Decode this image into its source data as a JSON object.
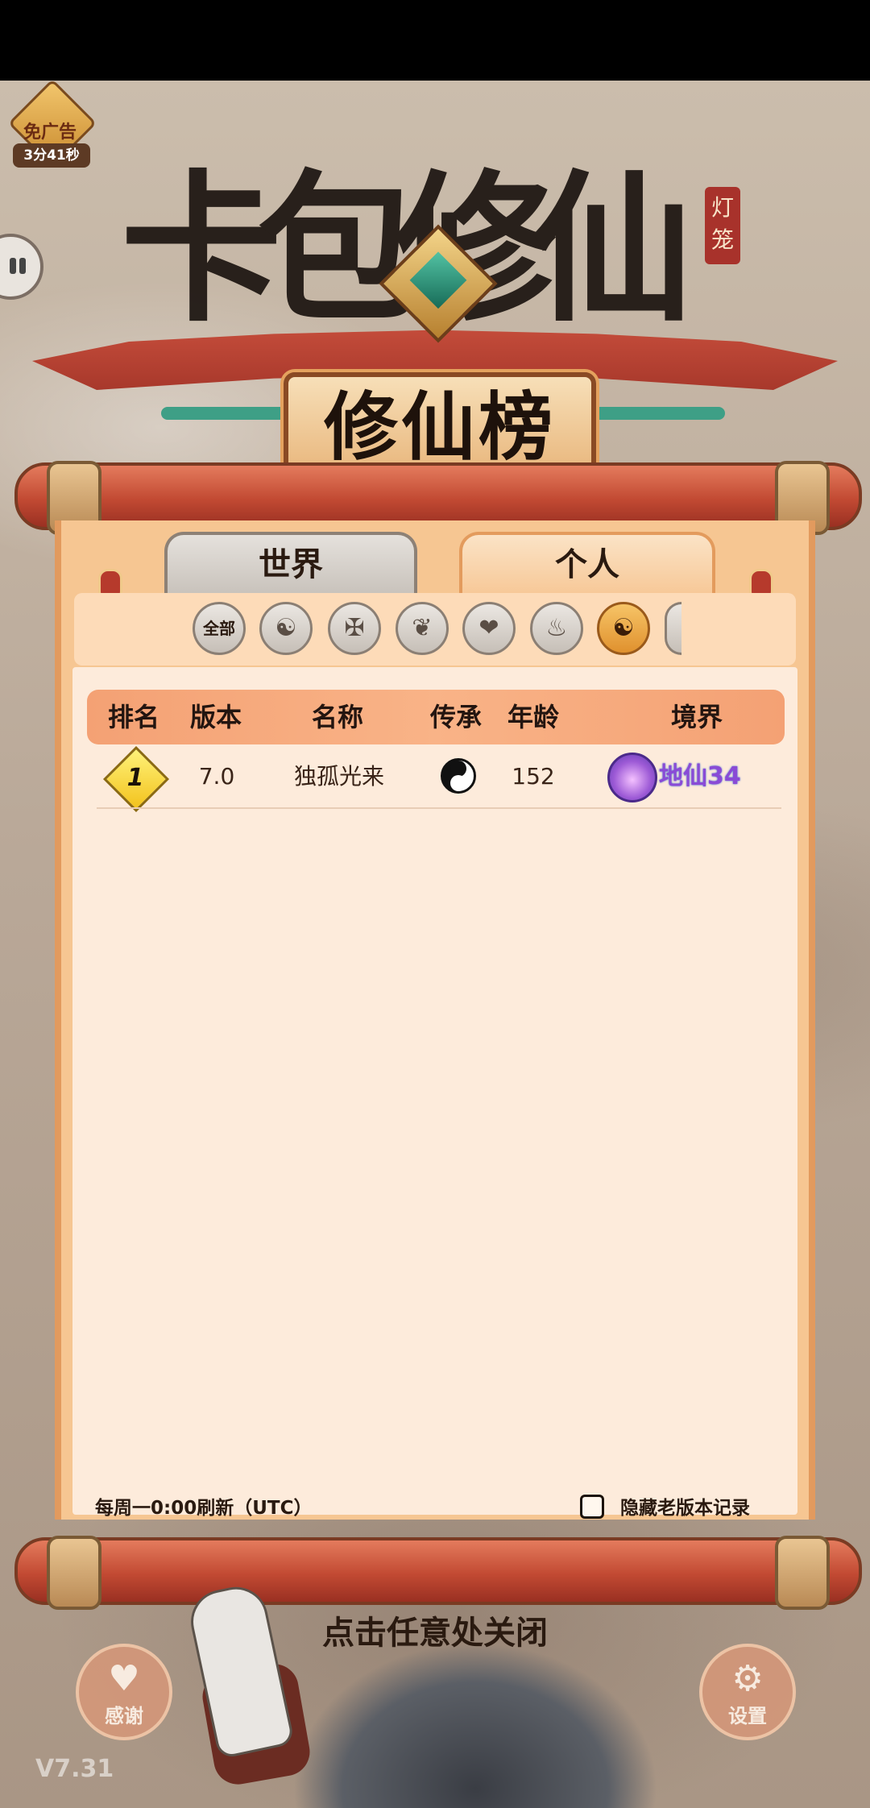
{
  "ad": {
    "label": "免广告",
    "timer": "3分41秒"
  },
  "title": {
    "game_name": "卡包修仙",
    "lantern_tag": "灯笼",
    "board_title": "修仙榜"
  },
  "tabs": [
    {
      "label": "世界"
    },
    {
      "label": "个人"
    }
  ],
  "filters": {
    "all_label": "全部",
    "selected_index": 6
  },
  "table": {
    "headers": [
      "排名",
      "版本",
      "名称",
      "传承",
      "年龄",
      "境界"
    ],
    "rows": [
      {
        "rank": "1",
        "version": "7.0",
        "name": "独孤光来",
        "lineage_icon": "yin-yang-icon",
        "age": "152",
        "realm": "地仙34"
      }
    ]
  },
  "footer": {
    "refresh_note": "每周一0:00刷新（UTC）",
    "hide_old_label": "隐藏老版本记录",
    "hide_old_checked": false
  },
  "close_hint": "点击任意处关闭",
  "buttons": {
    "thanks": "感谢",
    "settings": "设置"
  },
  "version": "V7.31",
  "colors": {
    "tab_active": "#f7c897",
    "tab_inactive": "#c8c2bb",
    "header_row": "#f4a174",
    "panel": "#fdebdb",
    "realm_text": "#8a4bd6"
  }
}
